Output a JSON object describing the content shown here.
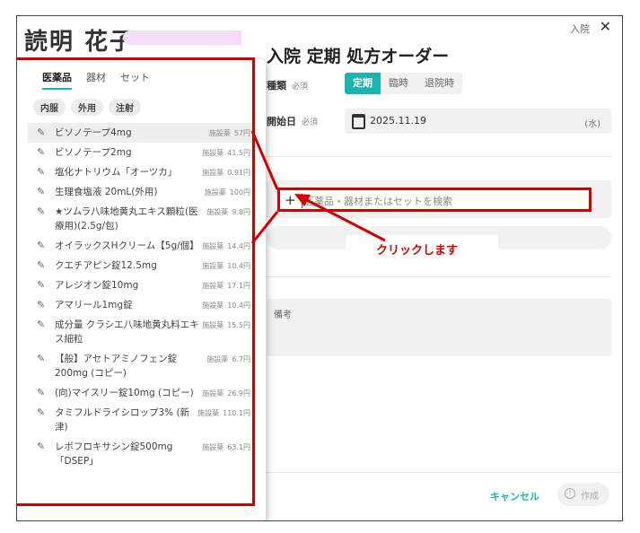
{
  "patient": {
    "name_partial": "読明 花子"
  },
  "dialog": {
    "header_label": "入院",
    "close_symbol": "✕",
    "title": "入院 定期 処方オーダー",
    "kind_label": "種類",
    "required": "必須",
    "kind_tabs": [
      "定期",
      "臨時",
      "退院時"
    ],
    "start_label": "開始日",
    "start_date": "2025.11.19",
    "day_of_week": "(水)",
    "search_placeholder": "医薬品・器材またはセットを検索",
    "memo_label": "備考",
    "cancel_label": "キャンセル",
    "create_label": "作成"
  },
  "annotation": {
    "text": "クリックします"
  },
  "panel": {
    "tabs": [
      "医薬品",
      "器材",
      "セット"
    ],
    "chips": [
      "内服",
      "外用",
      "注射"
    ],
    "items": [
      {
        "name": "ビソノテープ4mg",
        "tag": "施設薬",
        "price": "57円"
      },
      {
        "name": "ビソノテープ2mg",
        "tag": "施設薬",
        "price": "41.5円"
      },
      {
        "name": "塩化ナトリウム「オーツカ」",
        "tag": "施設薬",
        "price": "0.91円"
      },
      {
        "name": "生理食塩液 20mL(外用)",
        "tag": "施設薬",
        "price": "100円"
      },
      {
        "name": "★ツムラ八味地黄丸エキス顆粒(医療用)(2.5g/包)",
        "tag": "施設薬",
        "price": "9.8円"
      },
      {
        "name": "オイラックスHクリーム【5g/個】",
        "tag": "施設薬",
        "price": "14.4円"
      },
      {
        "name": "クエチアピン錠12.5mg",
        "tag": "施設薬",
        "price": "10.4円"
      },
      {
        "name": "アレジオン錠10mg",
        "tag": "施設薬",
        "price": "17.1円"
      },
      {
        "name": "アマリール1mg錠",
        "tag": "施設薬",
        "price": "10.4円"
      },
      {
        "name": "成分量 クラシエ八味地黄丸料エキス細粒",
        "tag": "施設薬",
        "price": "15.5円"
      },
      {
        "name": "【般】アセトアミノフェン錠200mg (コピー)",
        "tag": "施設薬",
        "price": "6.7円"
      },
      {
        "name": "(向)マイスリー錠10mg (コピー)",
        "tag": "施設薬",
        "price": "26.9円"
      },
      {
        "name": "タミフルドライシロップ3% (新津)",
        "tag": "施設薬",
        "price": "110.1円"
      },
      {
        "name": "レボフロキサシン錠500mg「DSEP」",
        "tag": "施設薬",
        "price": "63.1円"
      }
    ]
  },
  "colors": {
    "accent": "#1cb4ae",
    "annotation": "#d40000"
  }
}
